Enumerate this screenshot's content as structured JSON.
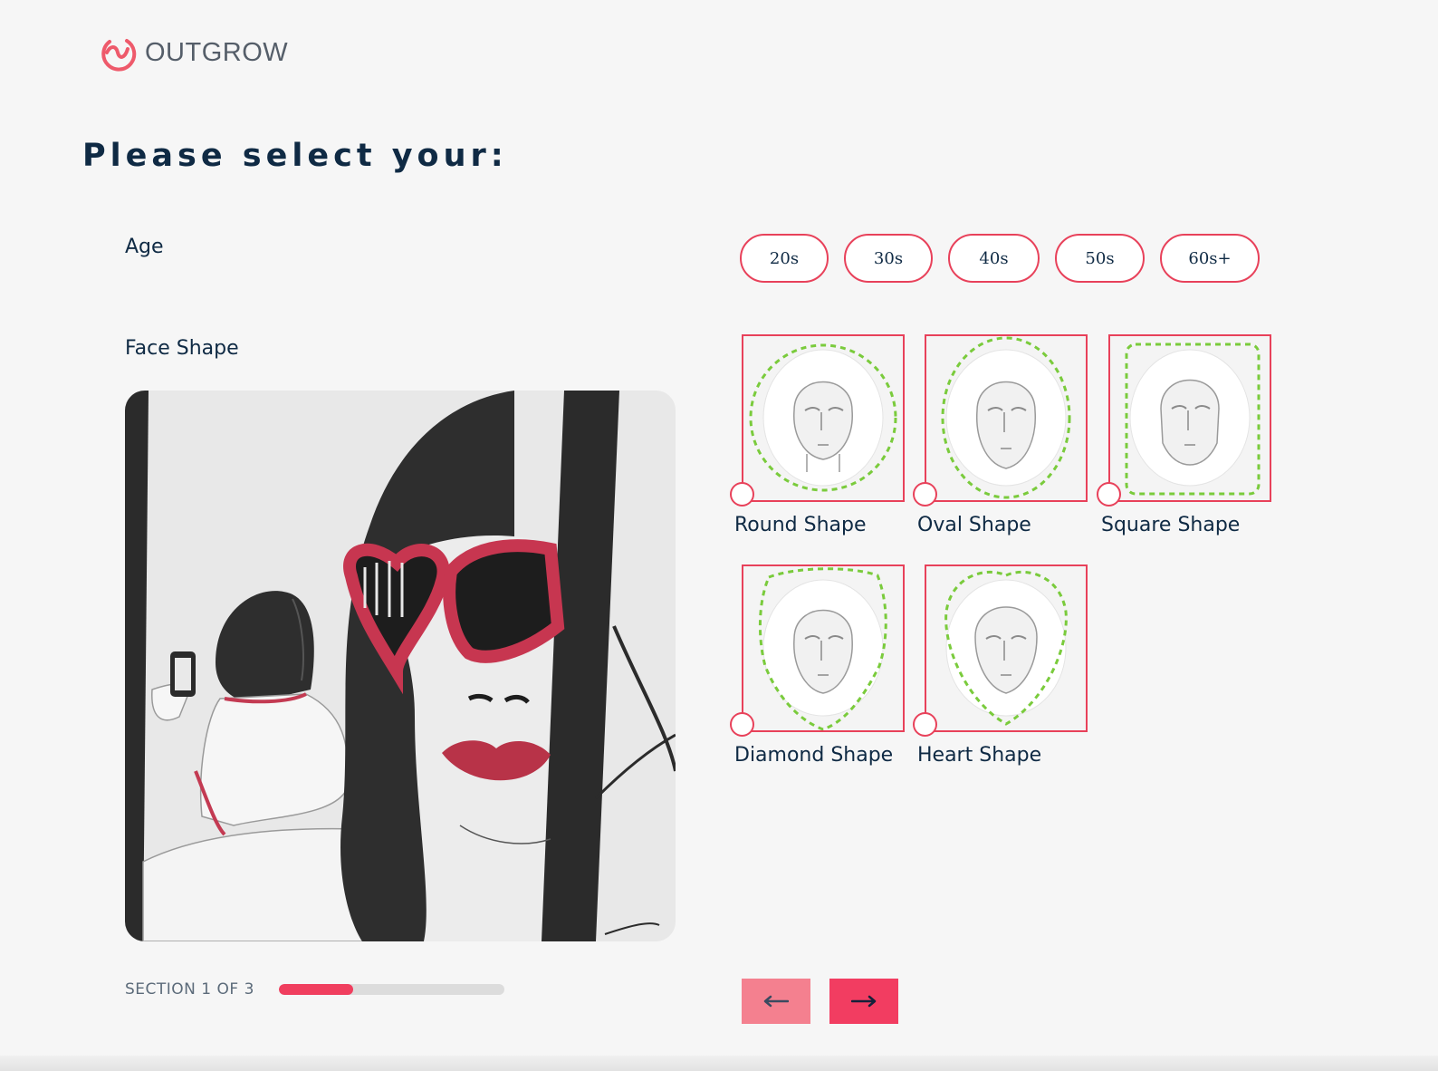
{
  "brand": {
    "name": "OUTGROW",
    "accent": "#e8415a"
  },
  "heading": "Please select your:",
  "questions": {
    "age": {
      "label": "Age",
      "options": [
        "20s",
        "30s",
        "40s",
        "50s",
        "60s+"
      ]
    },
    "face_shape": {
      "label": "Face Shape",
      "options": [
        "Round Shape",
        "Oval Shape",
        "Square Shape",
        "Diamond Shape",
        "Heart Shape"
      ]
    }
  },
  "progress": {
    "text": "SECTION 1 OF 3",
    "fraction": 0.33
  },
  "nav": {
    "prev_icon": "arrow-left-icon",
    "next_icon": "arrow-right-icon"
  },
  "colors": {
    "primary": "#f23d61",
    "primary_light": "#f4808f",
    "text": "#0f2a44",
    "outline_green": "#7acb3c"
  }
}
